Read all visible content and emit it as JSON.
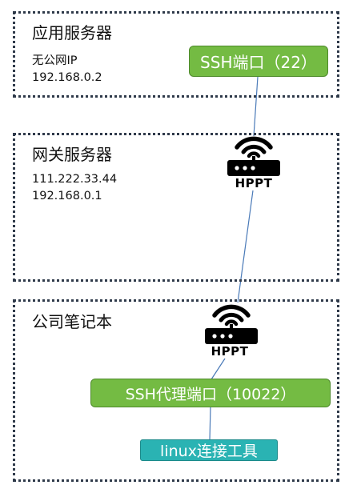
{
  "app_server": {
    "title": "应用服务器",
    "lines": [
      "无公网IP",
      "192.168.0.2"
    ],
    "port_label": "SSH端口（22）"
  },
  "gateway_server": {
    "title": "网关服务器",
    "lines": [
      "111.222.33.44",
      "192.168.0.1"
    ],
    "router_label": "HPPT"
  },
  "laptop": {
    "title": "公司笔记本",
    "router_label": "HPPT",
    "proxy_label": "SSH代理端口（10022）",
    "tool_label": "linux连接工具"
  },
  "colors": {
    "zone_border": "#2f3a4a",
    "green_box": "#74bb43",
    "teal_box": "#2ab3b3",
    "connector": "#4a7ab8"
  },
  "icons": {
    "router": "router-icon"
  }
}
